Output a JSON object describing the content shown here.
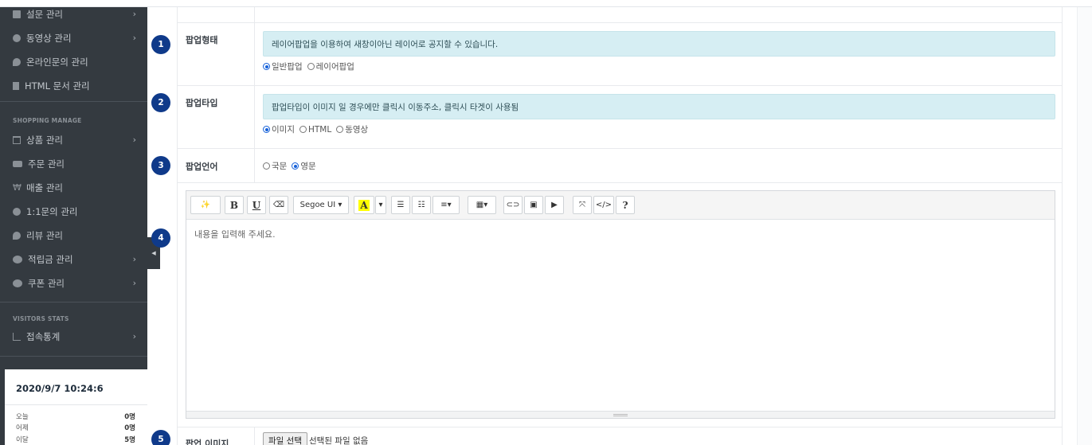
{
  "sidebar": {
    "items_top": [
      {
        "label": "설문 관리",
        "icon": "document-icon",
        "chevron": "›"
      },
      {
        "label": "동영상 관리",
        "icon": "play-icon",
        "chevron": "›"
      },
      {
        "label": "온라인문의 관리",
        "icon": "chat-icon",
        "chevron": ""
      },
      {
        "label": "HTML 문서 관리",
        "icon": "file-icon",
        "chevron": ""
      }
    ],
    "shopping_heading": "SHOPPING MANAGE",
    "items_shop": [
      {
        "label": "상품 관리",
        "icon": "cart-icon",
        "chevron": "›"
      },
      {
        "label": "주문 관리",
        "icon": "truck-icon",
        "chevron": ""
      },
      {
        "label": "매출 관리",
        "icon": "won-icon",
        "chevron": ""
      },
      {
        "label": "1:1문의 관리",
        "icon": "question-icon",
        "chevron": ""
      },
      {
        "label": "리뷰 관리",
        "icon": "chat-icon",
        "chevron": ""
      },
      {
        "label": "적립금 관리",
        "icon": "piggy-bank-icon",
        "chevron": "›"
      },
      {
        "label": "쿠폰 관리",
        "icon": "piggy-bank-icon",
        "chevron": "›"
      }
    ],
    "visitors_heading": "VISITORS STATS",
    "items_visitors": [
      {
        "label": "접속통계",
        "icon": "chart-icon",
        "chevron": "›"
      }
    ],
    "clock": "2020/9/7 10:24:6",
    "stats": [
      {
        "label": "오늘",
        "value": "0명"
      },
      {
        "label": "어제",
        "value": "0명"
      },
      {
        "label": "이달",
        "value": "5명"
      }
    ],
    "collapse_glyph": "◀"
  },
  "form": {
    "badges": [
      "1",
      "2",
      "3",
      "4",
      "5"
    ],
    "popup_form": {
      "label": "팝업형태",
      "notice": "레이어팝업을 이용하여 새창이아닌 레이어로 공지할 수 있습니다.",
      "options": [
        {
          "label": "일반팝업",
          "checked": true
        },
        {
          "label": "레이어팝업",
          "checked": false
        }
      ]
    },
    "popup_type": {
      "label": "팝업타입",
      "notice": "팝업타입이 이미지 일 경우에만 클릭시 이동주소, 클릭시 타겟이 사용됨",
      "options": [
        {
          "label": "이미지",
          "checked": true
        },
        {
          "label": "HTML",
          "checked": false
        },
        {
          "label": "동영상",
          "checked": false
        }
      ]
    },
    "popup_language": {
      "label": "팝업언어",
      "options": [
        {
          "label": "국문",
          "checked": false
        },
        {
          "label": "영문",
          "checked": true
        }
      ]
    },
    "editor": {
      "font_name": "Segoe UI",
      "placeholder": "내용을 입력해 주세요.",
      "toolbar": {
        "magic": "✨",
        "bold": "B",
        "underline": "U",
        "eraser": "⌫",
        "font_caret": "▾",
        "color_letter": "A",
        "color_caret": "▾",
        "ul": "☰",
        "ol": "☷",
        "align": "≡▾",
        "table": "▦▾",
        "link": "⊂⊃",
        "picture": "▣",
        "video": "▶",
        "fullscreen": "⤧",
        "code": "</>",
        "help": "?"
      }
    },
    "popup_image": {
      "label": "팝업 이미지",
      "button": "파일 선택",
      "status": "선택된 파일 없음"
    }
  }
}
